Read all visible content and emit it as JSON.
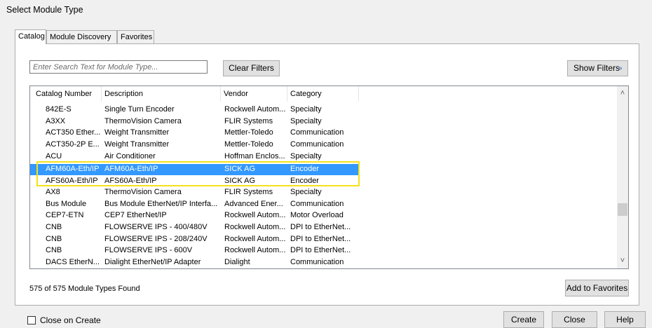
{
  "window": {
    "title": "Select Module Type"
  },
  "tabs": [
    {
      "label": "Catalog"
    },
    {
      "label": "Module Discovery"
    },
    {
      "label": "Favorites"
    }
  ],
  "search": {
    "placeholder": "Enter Search Text for Module Type..."
  },
  "buttons": {
    "clear_filters": "Clear Filters",
    "show_filters": "Show Filters",
    "add_to_favorites": "Add to Favorites",
    "create": "Create",
    "close": "Close",
    "help": "Help"
  },
  "table": {
    "columns": [
      "Catalog Number",
      "Description",
      "Vendor",
      "Category"
    ],
    "rows": [
      [
        "842E-S",
        "Single Turn Encoder",
        "Rockwell Autom...",
        "Specialty"
      ],
      [
        "A3XX",
        "ThermoVision Camera",
        "FLIR Systems",
        "Specialty"
      ],
      [
        "ACT350 Ether...",
        "Weight Transmitter",
        "Mettler-Toledo",
        "Communication"
      ],
      [
        "ACT350-2P E...",
        "Weight Transmitter",
        "Mettler-Toledo",
        "Communication"
      ],
      [
        "ACU",
        "Air Conditioner",
        "Hoffman Enclos...",
        "Specialty"
      ],
      [
        "AFM60A-Eth/IP",
        "AFM60A-Eth/IP",
        "SICK AG",
        "Encoder"
      ],
      [
        "AFS60A-Eth/IP",
        "AFS60A-Eth/IP",
        "SICK AG",
        "Encoder"
      ],
      [
        "AX8",
        "ThermoVision Camera",
        "FLIR Systems",
        "Specialty"
      ],
      [
        "Bus Module",
        "Bus Module EtherNet/IP Interfa...",
        "Advanced Ener...",
        "Communication"
      ],
      [
        "CEP7-ETN",
        "CEP7 EtherNet/IP",
        "Rockwell Autom...",
        "Motor Overload"
      ],
      [
        "CNB",
        "FLOWSERVE IPS - 400/480V",
        "Rockwell Autom...",
        "DPI to EtherNet..."
      ],
      [
        "CNB",
        "FLOWSERVE IPS - 208/240V",
        "Rockwell Autom...",
        "DPI to EtherNet..."
      ],
      [
        "CNB",
        "FLOWSERVE IPS - 600V",
        "Rockwell Autom...",
        "DPI to EtherNet..."
      ],
      [
        "DACS EtherN...",
        "Dialight EtherNet/IP Adapter",
        "Dialight",
        "Communication"
      ]
    ],
    "selected_row_index": 5
  },
  "status": {
    "found_text": "575 of 575 Module Types Found"
  },
  "close_on_create": {
    "label": "Close on Create",
    "checked": false
  },
  "colors": {
    "selection": "#3399ff",
    "highlight_box": "#f5e21b"
  },
  "icons": {
    "show_filters": "double-chevron-down-icon",
    "scroll_up": "chevron-up-icon",
    "scroll_down": "chevron-down-icon"
  }
}
